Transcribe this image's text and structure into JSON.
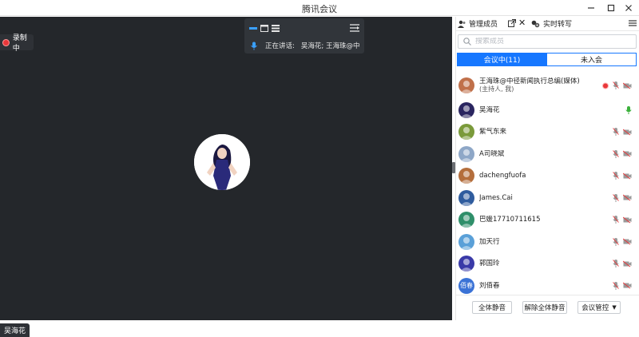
{
  "window": {
    "title": "腾讯会议"
  },
  "recording": {
    "label": "录制中"
  },
  "speaking": {
    "prefix": "正在讲话:",
    "names": "吴海花; 王海珠@中"
  },
  "video": {
    "current_name": "吴海花"
  },
  "panel": {
    "tab_members": "管理成员",
    "tab_transcript": "实时转写",
    "search_placeholder": "搜索成员",
    "seg_in": "会议中(11)",
    "seg_out": "未入会",
    "members": [
      {
        "name": "王海珠@中径新闻执行总编(媒体)",
        "role": "(主持人, 我)",
        "mic": "muted",
        "rec": true,
        "av_color": "#c0704a"
      },
      {
        "name": "吴海花",
        "role": "",
        "mic": "speaking",
        "rec": false,
        "av_color": "#2a2560"
      },
      {
        "name": "紫气东来",
        "role": "",
        "mic": "muted",
        "rec": false,
        "av_color": "#7a9a3a"
      },
      {
        "name": "A司晓斌",
        "role": "",
        "mic": "muted",
        "rec": false,
        "av_color": "#8ea7c7"
      },
      {
        "name": "dachengfuofa",
        "role": "",
        "mic": "muted",
        "rec": false,
        "av_color": "#b46e3c"
      },
      {
        "name": "James.Cai",
        "role": "",
        "mic": "muted",
        "rec": false,
        "av_color": "#2f5c9e"
      },
      {
        "name": "巴媛17710711615",
        "role": "",
        "mic": "muted",
        "rec": false,
        "av_color": "#2f8f6a"
      },
      {
        "name": "加天行",
        "role": "",
        "mic": "muted",
        "rec": false,
        "av_color": "#5aa0d8"
      },
      {
        "name": "郭国玲",
        "role": "",
        "mic": "muted",
        "rec": false,
        "av_color": "#3a3aa8"
      },
      {
        "name": "刘佰春",
        "role": "",
        "mic": "muted",
        "rec": false,
        "av_color": "#3a72d6",
        "av_text": "佰春"
      }
    ],
    "btn_mute_all": "全体静音",
    "btn_unmute_all": "解除全体静音",
    "btn_meeting_ctrl": "会议管控"
  },
  "colors": {
    "accent": "#1677ff",
    "video_bg": "#24272b",
    "rec_red": "#e8373a",
    "mic_green": "#3cb13c"
  }
}
